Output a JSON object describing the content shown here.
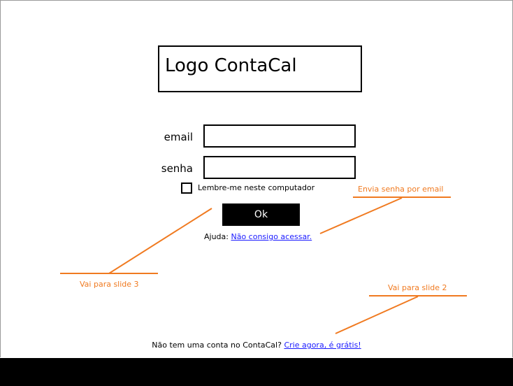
{
  "logo": {
    "text": "Logo ContaCal"
  },
  "login_form": {
    "email_label": "email",
    "email_value": "",
    "password_label": "senha",
    "password_value": "",
    "remember_label": "Lembre-me neste computador",
    "remember_checked": false,
    "ok_label": "Ok",
    "help_prefix": "Ajuda:",
    "help_link": "Não consigo acessar."
  },
  "signup": {
    "prefix": "Não tem uma conta no ContaCal?",
    "link": "Crie agora, é grátis!"
  },
  "annotations": {
    "email_note": "Envia senha por email",
    "slide3_note": "Vai para slide 3",
    "slide2_note": "Vai para slide 2",
    "color": "#f07a20"
  },
  "colors": {
    "link": "#1a1aff",
    "button_bg": "#000000",
    "button_text": "#ffffff",
    "bottom_bar": "#000000"
  }
}
